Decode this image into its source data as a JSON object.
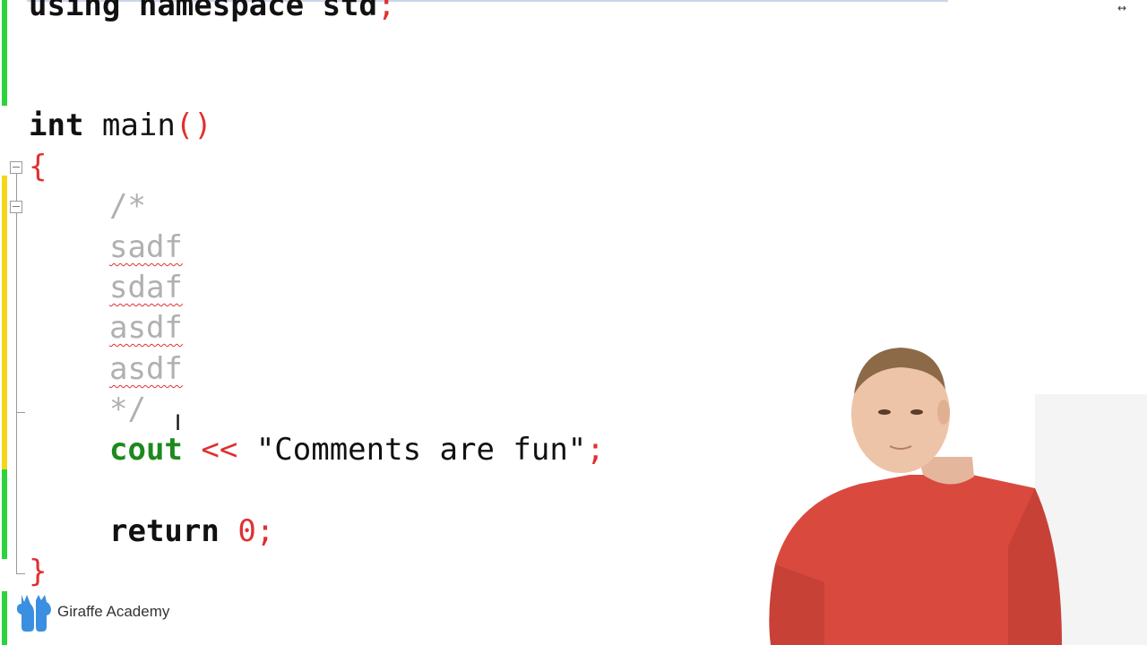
{
  "editor": {
    "line_using": {
      "kw1": "using",
      "kw2": "namespace",
      "ident": "std",
      "semi": ";"
    },
    "line_main": {
      "type": "int",
      "name": "main",
      "parens": "()"
    },
    "open_brace": "{",
    "comment_open": "/*",
    "comment_lines": [
      "sadf",
      "sdaf",
      "asdf",
      "asdf"
    ],
    "comment_close": "*/",
    "line_cout": {
      "cout": "cout",
      "op": "<<",
      "string": "\"Comments are fun\"",
      "semi": ";"
    },
    "line_return": {
      "kw": "return",
      "value": "0",
      "semi": ";"
    },
    "close_brace": "}"
  },
  "branding": {
    "name": "Giraffe Academy"
  },
  "colors": {
    "keyword": "#111111",
    "accent": "#e03030",
    "cout": "#1c8a1c",
    "comment": "#b0b0b0",
    "change_green": "#2bd43b",
    "change_yellow": "#f1d81a"
  },
  "icons": [
    "resize-icon",
    "fold-toggle-icon",
    "text-cursor-icon",
    "giraffe-logo-icon"
  ]
}
